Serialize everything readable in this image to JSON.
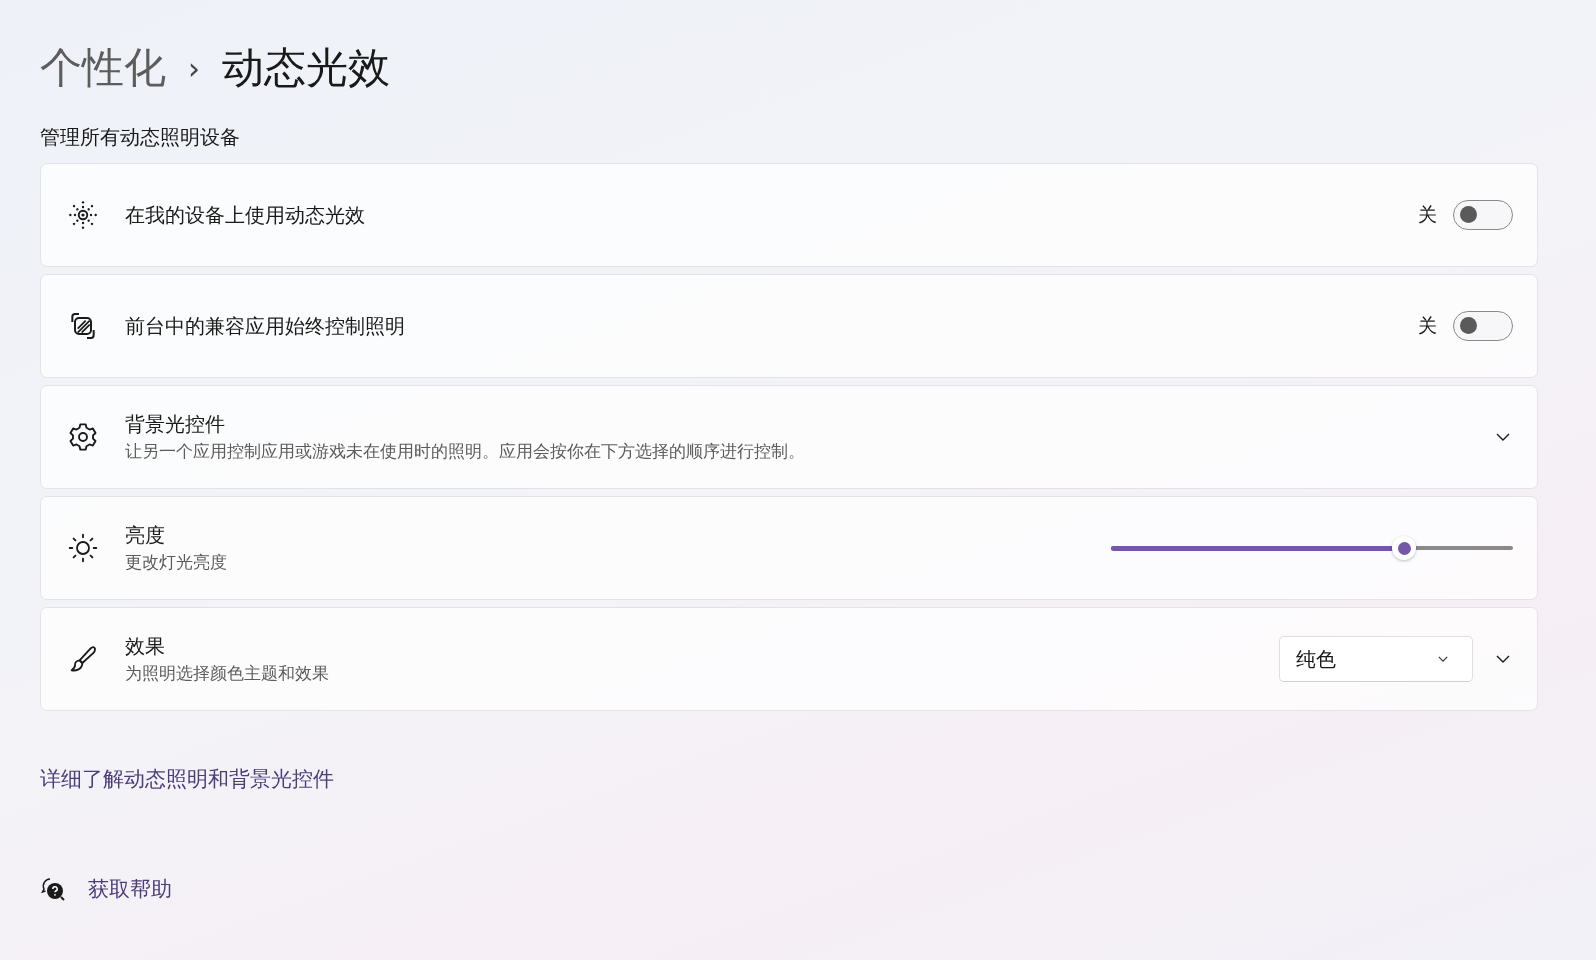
{
  "breadcrumb": {
    "parent": "个性化",
    "separator": "›",
    "current": "动态光效"
  },
  "section_title": "管理所有动态照明设备",
  "rows": [
    {
      "kind": "toggle",
      "title": "在我的设备上使用动态光效",
      "state_label": "关",
      "on": false
    },
    {
      "kind": "toggle",
      "title": "前台中的兼容应用始终控制照明",
      "state_label": "关",
      "on": false
    },
    {
      "kind": "expander",
      "title": "背景光控件",
      "subtitle": "让另一个应用控制应用或游戏未在使用时的照明。应用会按你在下方选择的顺序进行控制。",
      "expanded": false
    },
    {
      "kind": "slider",
      "title": "亮度",
      "subtitle": "更改灯光亮度",
      "level": 0.73
    },
    {
      "kind": "dropdown",
      "title": "效果",
      "subtitle": "为照明选择颜色主题和效果",
      "value": "纯色",
      "expanded": false
    }
  ],
  "link": "详细了解动态照明和背景光控件",
  "help": "获取帮助"
}
